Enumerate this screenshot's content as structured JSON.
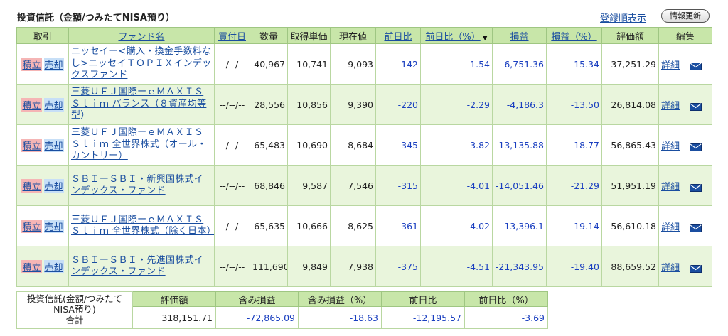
{
  "header": {
    "title": "投資信託（金額/つみたてNISA預り）",
    "order_link": "登録順表示",
    "refresh_button": "情報更新"
  },
  "columns": {
    "trade": "取引",
    "fund_name": "ファンド名",
    "buy_date": "買付日",
    "quantity": "数量",
    "unit_cost": "取得単価",
    "current_price": "現在値",
    "day_change": "前日比",
    "day_change_pct": "前日比（%）",
    "gain": "損益",
    "gain_pct": "損益（%）",
    "valuation": "評価額",
    "edit": "編集"
  },
  "sort_indicator": "▼",
  "row_labels": {
    "tsumitate": "積立",
    "baikyaku": "売却",
    "detail": "詳細"
  },
  "rows": [
    {
      "name": "ニッセイー<購入・換金手数料なし>ニッセイＴＯＰＩＸインデックスファンド",
      "date": "--/--/--",
      "qty": "40,967",
      "cost": "10,741",
      "price": "9,093",
      "chg": "-142",
      "chg_pct": "-1.54",
      "gain": "-6,751.36",
      "gain_pct": "-15.34",
      "value": "37,251.29"
    },
    {
      "name": "三菱ＵＦＪ国際ーｅＭＡＸＩＳ Ｓｌｉｍ バランス（８資産均等型）",
      "date": "--/--/--",
      "qty": "28,556",
      "cost": "10,856",
      "price": "9,390",
      "chg": "-220",
      "chg_pct": "-2.29",
      "gain": "-4,186.3",
      "gain_pct": "-13.50",
      "value": "26,814.08"
    },
    {
      "name": "三菱ＵＦＪ国際ーｅＭＡＸＩＳ Ｓｌｉｍ 全世界株式（オール・カントリー）",
      "date": "--/--/--",
      "qty": "65,483",
      "cost": "10,690",
      "price": "8,684",
      "chg": "-345",
      "chg_pct": "-3.82",
      "gain": "-13,135.88",
      "gain_pct": "-18.77",
      "value": "56,865.43"
    },
    {
      "name": "ＳＢＩーＳＢＩ・新興国株式インデックス・ファンド",
      "date": "--/--/--",
      "qty": "68,846",
      "cost": "9,587",
      "price": "7,546",
      "chg": "-315",
      "chg_pct": "-4.01",
      "gain": "-14,051.46",
      "gain_pct": "-21.29",
      "value": "51,951.19"
    },
    {
      "name": "三菱ＵＦＪ国際ーｅＭＡＸＩＳ Ｓｌｉｍ 全世界株式（除く日本）",
      "date": "--/--/--",
      "qty": "65,635",
      "cost": "10,666",
      "price": "8,625",
      "chg": "-361",
      "chg_pct": "-4.02",
      "gain": "-13,396.1",
      "gain_pct": "-19.14",
      "value": "56,610.18"
    },
    {
      "name": "ＳＢＩーＳＢＩ・先進国株式インデックス・ファンド",
      "date": "--/--/--",
      "qty": "111,690",
      "cost": "9,849",
      "price": "7,938",
      "chg": "-375",
      "chg_pct": "-4.51",
      "gain": "-21,343.95",
      "gain_pct": "-19.40",
      "value": "88,659.52"
    }
  ],
  "summary": {
    "label_line1": "投資信託(金額/つみたて",
    "label_line2": "NISA預り)",
    "label_line3": "合計",
    "headers": {
      "valuation": "評価額",
      "unrealized_gain": "含み損益",
      "unrealized_gain_pct": "含み損益（%）",
      "day_change": "前日比",
      "day_change_pct": "前日比（%）"
    },
    "values": {
      "valuation": "318,151.71",
      "unrealized_gain": "-72,865.09",
      "unrealized_gain_pct": "-18.63",
      "day_change": "-12,195.57",
      "day_change_pct": "-3.69"
    }
  },
  "colors": {
    "header_bg": "#c8e6a9",
    "row_alt_bg": "#e9f5dc",
    "negative": "#1a3fc0",
    "link": "#1a4ea0",
    "tsumitate_bg": "#f5b5b5",
    "baikyaku_bg": "#c7dff7"
  },
  "icons": {
    "mail": "mail-icon"
  }
}
